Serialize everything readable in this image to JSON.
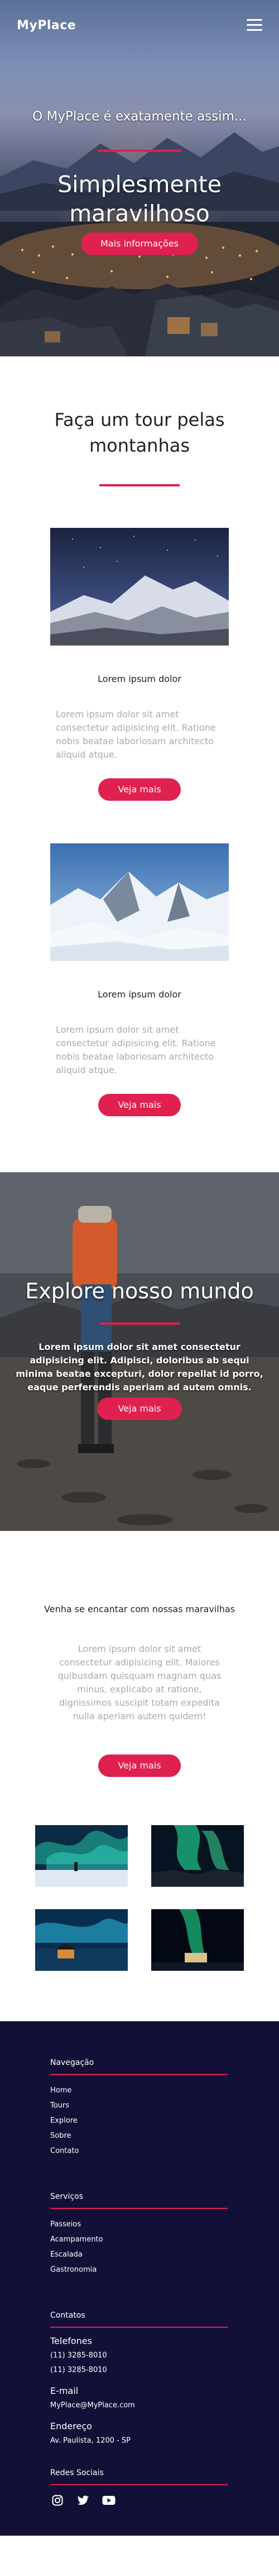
{
  "header": {
    "logo": "MyPlace",
    "menu_icon": "hamburger-menu-icon"
  },
  "hero": {
    "subtitle": "O MyPlace é exatamente assim...",
    "title_line1": "Simplesmente",
    "title_line2": "maravilhoso",
    "button": "Mais informações"
  },
  "tour": {
    "title_line1": "Faça um tour pelas",
    "title_line2": "montanhas",
    "cards": [
      {
        "title": "Lorem ipsum dolor",
        "text": "Lorem ipsum dolor sit amet consectetur adipisicing elit. Ratione nobis beatae laboriosam architecto aliquid atque.",
        "button": "Veja mais"
      },
      {
        "title": "Lorem ipsum dolor",
        "text": "Lorem ipsum dolor sit amet consectetur adipisicing elit. Ratione nobis beatae laboriosam architecto aliquid atque.",
        "button": "Veja mais"
      }
    ]
  },
  "explore": {
    "title": "Explore nosso mundo",
    "text": "Lorem ipsum dolor sit amet consectetur adipisicing elit. Adipisci, doloribus ab sequi minima beatae excepturi, dolor repellat id porro, eaque perferendis aperiam ad autem omnis.",
    "button": "Veja mais"
  },
  "encantar": {
    "title": "Venha se encantar com nossas maravilhas",
    "text": "Lorem ipsum dolor sit amet consectetur adipisicing elit. Maiores quibusdam quisquam magnam quas minus, explicabo at ratione, dignissimos suscipit totam expedita nulla aperiam autem quidem!",
    "button": "Veja mais"
  },
  "footer": {
    "navegacao": {
      "heading": "Navegação",
      "links": [
        "Home",
        "Tours",
        "Explore",
        "Sobre",
        "Contato"
      ]
    },
    "servicos": {
      "heading": "Serviços",
      "links": [
        "Passeios",
        "Acampamento",
        "Escalada",
        "Gastronomia"
      ]
    },
    "contatos": {
      "heading": "Contatos",
      "telefones_label": "Telefones",
      "phone1": "(11) 3285-8010",
      "phone2": "(11) 3285-8010",
      "email_label": "E-mail",
      "email": "MyPlace@MyPlace.com",
      "endereco_label": "Endereço",
      "endereco": "Av. Paulista, 1200 - SP"
    },
    "redes": {
      "heading": "Redes Sociais",
      "icons": [
        "instagram-icon",
        "twitter-icon",
        "youtube-icon"
      ]
    }
  },
  "colors": {
    "accent": "#e0204e",
    "footer_bg": "#131038",
    "muted_text": "#aaaaaa"
  }
}
